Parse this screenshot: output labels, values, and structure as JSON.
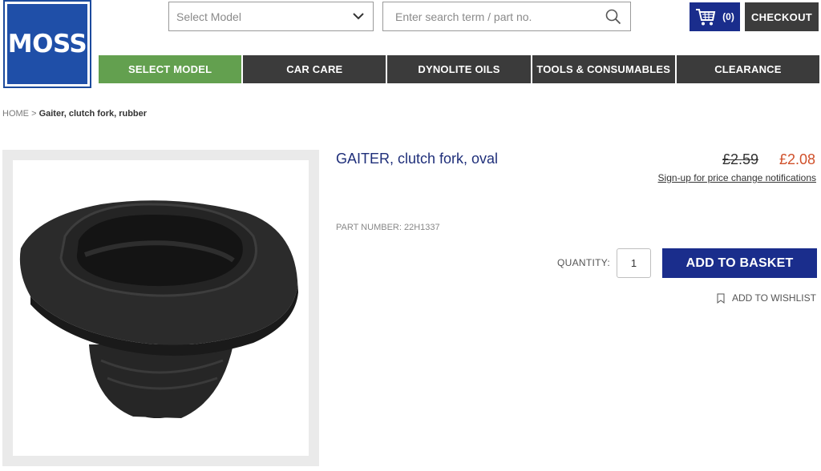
{
  "header": {
    "logo_text": "MOSS",
    "model_select": {
      "placeholder": "Select Model"
    },
    "search": {
      "placeholder": "Enter search term / part no."
    },
    "cart": {
      "count": "(0)",
      "icon": "cart-icon"
    },
    "checkout_label": "CHECKOUT"
  },
  "nav": {
    "items": [
      {
        "label": "SELECT MODEL",
        "active": true
      },
      {
        "label": "CAR CARE",
        "active": false
      },
      {
        "label": "DYNOLITE OILS",
        "active": false
      },
      {
        "label": "TOOLS & CONSUMABLES",
        "active": false
      },
      {
        "label": "CLEARANCE",
        "active": false
      }
    ]
  },
  "breadcrumb": {
    "home": "HOME",
    "separator": ">",
    "current": "Gaiter, clutch fork, rubber"
  },
  "product": {
    "title": "GAITER, clutch fork, oval",
    "price_old": "£2.59",
    "price_new": "£2.08",
    "price_notify": "Sign-up for price change notifications",
    "part_number_label": "PART NUMBER:",
    "part_number": "22H1337",
    "quantity_label": "QUANTITY:",
    "quantity_value": "1",
    "add_to_basket": "ADD TO BASKET",
    "add_to_wishlist": "ADD TO WISHLIST"
  },
  "colors": {
    "brand_blue": "#1f4fa8",
    "button_blue": "#1a2d8c",
    "nav_dark": "#3b3b3b",
    "nav_active_green": "#63a04f",
    "sale_price": "#d0502a",
    "title_blue": "#1f2f7a"
  }
}
